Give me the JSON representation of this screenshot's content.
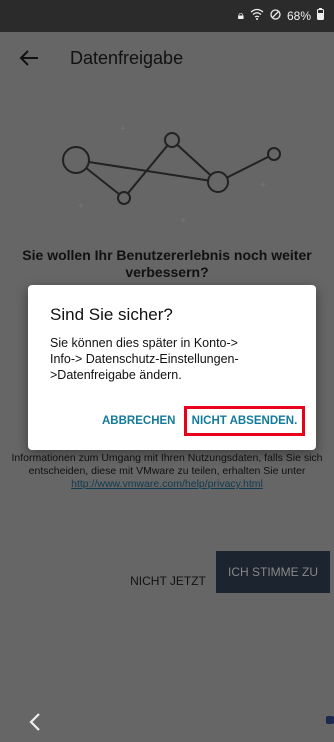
{
  "status_bar": {
    "lock_icon": "lock-icon",
    "wifi_icon": "wifi-icon",
    "no_signal_icon": "blocked-icon",
    "battery_percent": "68%",
    "battery_icon": "battery-icon"
  },
  "app_bar": {
    "back_icon": "arrow-left-icon",
    "title": "Datenfreigabe"
  },
  "content": {
    "heading": "Sie wollen Ihr Benutzererlebnis noch weiter verbessern?",
    "info_text": "Informationen zum Umgang mit Ihren Nutzungsdaten, falls Sie sich entscheiden, diese mit VMware zu teilen, erhalten Sie unter",
    "info_link": "http://www.vmware.com/help/privacy.html",
    "btn_not_now": "NICHT JETZT",
    "btn_agree": "ICH STIMME ZU"
  },
  "dialog": {
    "title": "Sind Sie sicher?",
    "message": "Sie können dies später in Konto-> Info-> Datenschutz-Einstellungen->Datenfreigabe ändern.",
    "cancel_label": "ABBRECHEN",
    "confirm_label": "NICHT ABSENDEN."
  },
  "nav": {
    "back_icon": "chevron-left-icon"
  },
  "colors": {
    "accent": "#137b9a",
    "highlight": "#e8001c",
    "button_dark": "#1c2430"
  }
}
